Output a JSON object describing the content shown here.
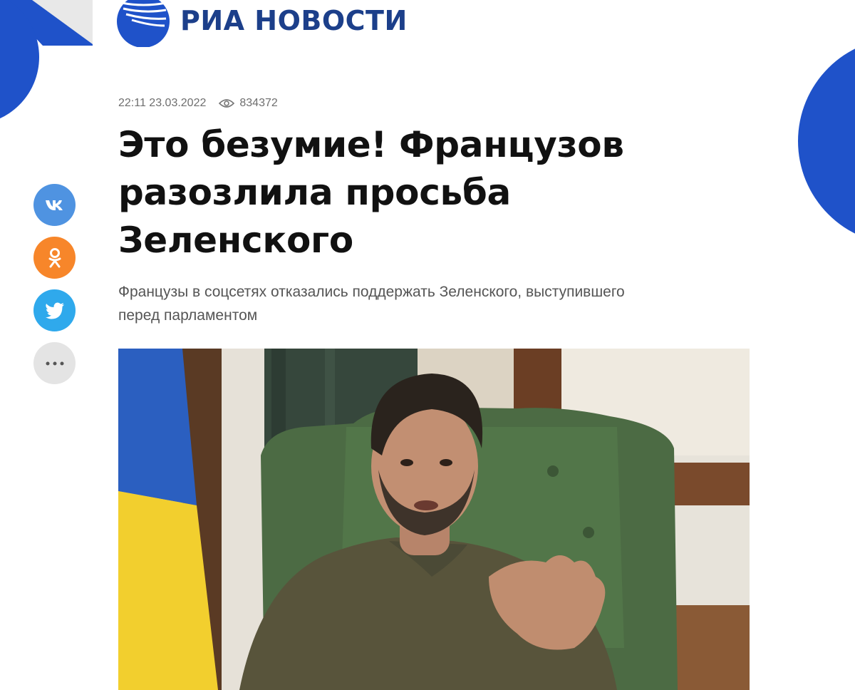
{
  "site": {
    "logo_text": "РИА НОВОСТИ",
    "brand_color": "#1f52c9"
  },
  "article": {
    "time": "22:11 23.03.2022",
    "views": "834372",
    "headline": "Это безумие! Французов разозлила просьба Зеленского",
    "subtitle": "Французы в соцсетях отказались поддержать Зеленского, выступившего перед парламентом"
  },
  "share": {
    "buttons": [
      {
        "name": "vk",
        "icon": "vk-icon",
        "color": "#4f93e1"
      },
      {
        "name": "odnoklassniki",
        "icon": "odnoklassniki-icon",
        "color": "#f7862a"
      },
      {
        "name": "twitter",
        "icon": "twitter-bird-icon",
        "color": "#2fa9ec"
      },
      {
        "name": "more",
        "icon": "more-dots-icon",
        "color": "#e4e4e4"
      }
    ]
  },
  "photo": {
    "icon": "article-photo"
  }
}
